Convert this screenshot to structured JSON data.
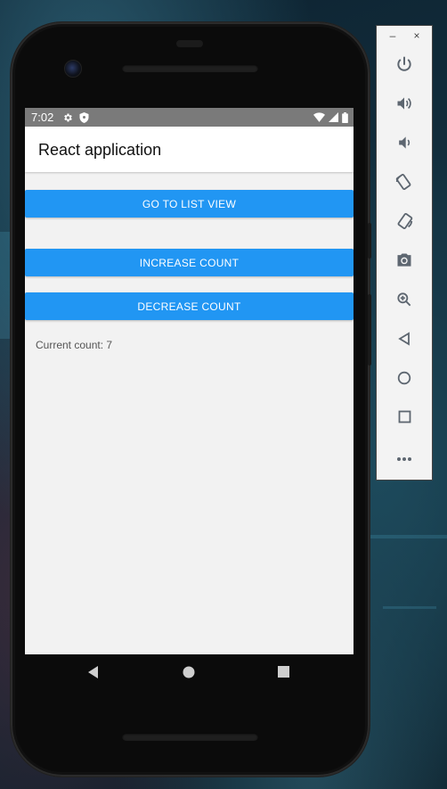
{
  "status_bar": {
    "time": "7:02"
  },
  "app_bar": {
    "title": "React application"
  },
  "buttons": {
    "go_to_list": "GO TO LIST VIEW",
    "increase": "INCREASE COUNT",
    "decrease": "DECREASE COUNT"
  },
  "counter": {
    "text": "Current count: 7"
  },
  "emulator_toolbar": {
    "minimize_label": "–",
    "close_label": "×",
    "icons": [
      "power-icon",
      "volume-up-icon",
      "volume-down-icon",
      "rotate-left-icon",
      "rotate-right-icon",
      "camera-icon",
      "zoom-icon",
      "back-icon",
      "home-icon",
      "overview-icon",
      "more-icon"
    ]
  },
  "colors": {
    "accent": "#2196f3",
    "status_bar": "#7a7a7a",
    "screen_bg": "#f2f2f2"
  }
}
